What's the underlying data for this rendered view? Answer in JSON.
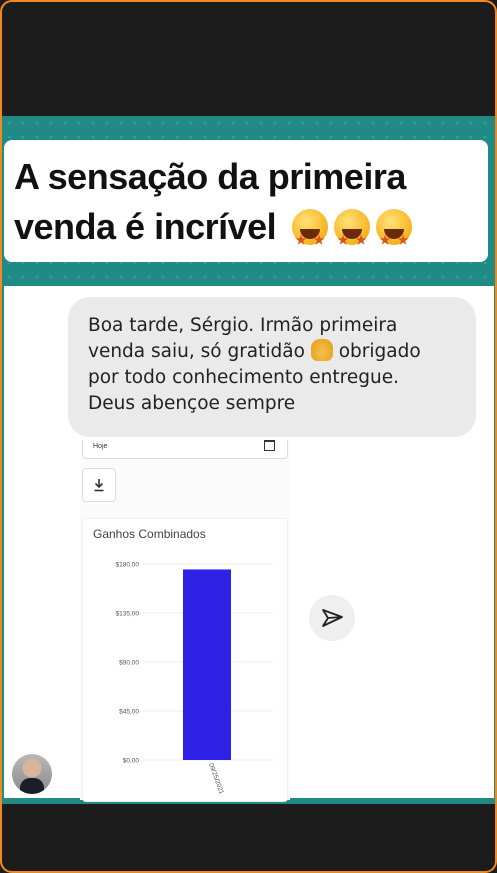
{
  "headline": "A sensação da primeira venda é incrível",
  "headline_emojis": [
    "star-struck-emoji",
    "star-struck-emoji",
    "star-struck-emoji"
  ],
  "message": {
    "line1": "Boa tarde, Sérgio. Irmão primeira",
    "line2_before": "venda saiu, só gratidão",
    "line2_after": "obrigado",
    "line3": "por todo conhecimento entregue.",
    "line4": "Deus abençoe sempre",
    "emoji": "praying-hands-emoji"
  },
  "dashboard": {
    "date_label": "Hoje",
    "download_icon": "download-icon",
    "calendar_icon": "calendar-icon"
  },
  "chart_data": {
    "type": "bar",
    "title": "Ganhos Combinados",
    "categories": [
      "09/25/2021"
    ],
    "values": [
      175
    ],
    "ylim": [
      0,
      180
    ],
    "yticks": [
      "$0,00",
      "$45,00",
      "$90,00",
      "$135,00",
      "$180,00"
    ],
    "ytick_values": [
      0,
      45,
      90,
      135,
      180
    ],
    "bar_color": "#2e22e6",
    "grid": true
  },
  "send_icon": "send-icon",
  "avatar": "user-avatar",
  "colors": {
    "teal": "#1f8a86",
    "frame_orange": "#f08a1c",
    "bar": "#2e22e6"
  }
}
